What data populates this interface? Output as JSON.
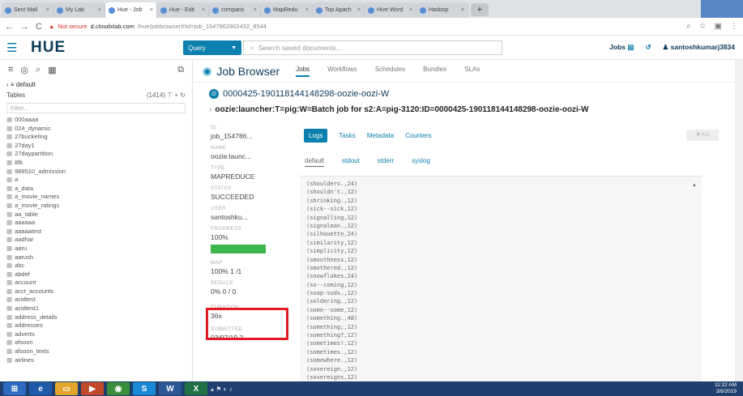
{
  "browser": {
    "tabs": [
      {
        "label": "Sent Mail"
      },
      {
        "label": "My Lab"
      },
      {
        "label": "Hue - Job",
        "active": true
      },
      {
        "label": "Hue - Edit"
      },
      {
        "label": "comparis"
      },
      {
        "label": "MapRedu"
      },
      {
        "label": "Top Apach"
      },
      {
        "label": "Hive Word"
      },
      {
        "label": "Hadoop"
      }
    ],
    "security_warning": "Not secure",
    "url_host": "d.cloudxlab.com",
    "url_path": "/hue/jobbrowser#!id=job_1547862802432_8544"
  },
  "hue": {
    "logo": "HUE",
    "query_button": "Query",
    "search_placeholder": "Search saved documents...",
    "jobs_label": "Jobs",
    "username": "santoshkumarj3834"
  },
  "assist": {
    "database": "default",
    "tables_label": "Tables",
    "tables_count": "(1414)",
    "filter_placeholder": "Filter...",
    "tables": [
      "000aaaa",
      "024_dynamic",
      "27bucketing",
      "27day1",
      "27daypartition",
      "8fk",
      "989510_admission",
      "a",
      "a_data",
      "a_movie_names",
      "a_movie_ratings",
      "aa_table",
      "aaaaaa",
      "aaaaatest",
      "aadhar",
      "aaru",
      "aarush",
      "abc",
      "abdef",
      "account",
      "acct_accounts",
      "acidtest",
      "acidtest1",
      "address_details",
      "addresses",
      "adverts",
      "afsoon",
      "afsoon_texts",
      "airlines"
    ]
  },
  "jobbrowser": {
    "title": "Job Browser",
    "tabs": [
      "Jobs",
      "Workflows",
      "Schedules",
      "Bundles",
      "SLAs"
    ],
    "job_id": "0000425-190118144148298-oozie-oozi-W",
    "job_name": "oozie:launcher:T=pig:W=Batch job for s2:A=pig-3120:ID=0000425-190118144148298-oozie-oozi-W",
    "properties": {
      "id_label": "ID",
      "id_value": "job_154786...",
      "name_label": "NAME",
      "name_value": "oozie:launc...",
      "type_label": "TYPE",
      "type_value": "MAPREDUCE",
      "status_label": "STATUS",
      "status_value": "SUCCEEDED",
      "user_label": "USER",
      "user_value": "santoshku...",
      "progress_label": "PROGRESS",
      "progress_value": "100%",
      "progress_fraction": 1.0,
      "map_label": "MAP",
      "map_value": "100% 1 /1",
      "reduce_label": "REDUCE",
      "reduce_value": "0% 0 / 0",
      "duration_label": "DURATION",
      "duration_value": "36s",
      "submitted_label": "SUBMITTED",
      "submitted_value": "03/07/19 2..."
    },
    "subtabs": [
      "Logs",
      "Tasks",
      "Metadata",
      "Counters"
    ],
    "kill_label": "Kill",
    "log_tabs": [
      "default",
      "stdout",
      "stderr",
      "syslog"
    ],
    "log_lines": [
      "(shoulders.,24)",
      "(shouldn't.,12)",
      "(shrinking.,12)",
      "(sick--sick,12)",
      "(signalling,12)",
      "(signalman.,12)",
      "(silhouette,24)",
      "(similarity,12)",
      "(simplicity,12)",
      "(smoothness,12)",
      "(smothered.,12)",
      "(snowflakes,24)",
      "(so--coming,12)",
      "(soap-suds.,12)",
      "(soldering.,12)",
      "(some--some,12)",
      "(something.,48)",
      "(something;,12)",
      "(something?,12)",
      "(sometimes!,12)",
      "(sometimes.,12)",
      "(somewhere.,12)",
      "(sovereign.,12)",
      "(sovereigns,12)"
    ]
  },
  "taskbar": {
    "time": "11:22 AM",
    "date": "3/8/2019"
  }
}
